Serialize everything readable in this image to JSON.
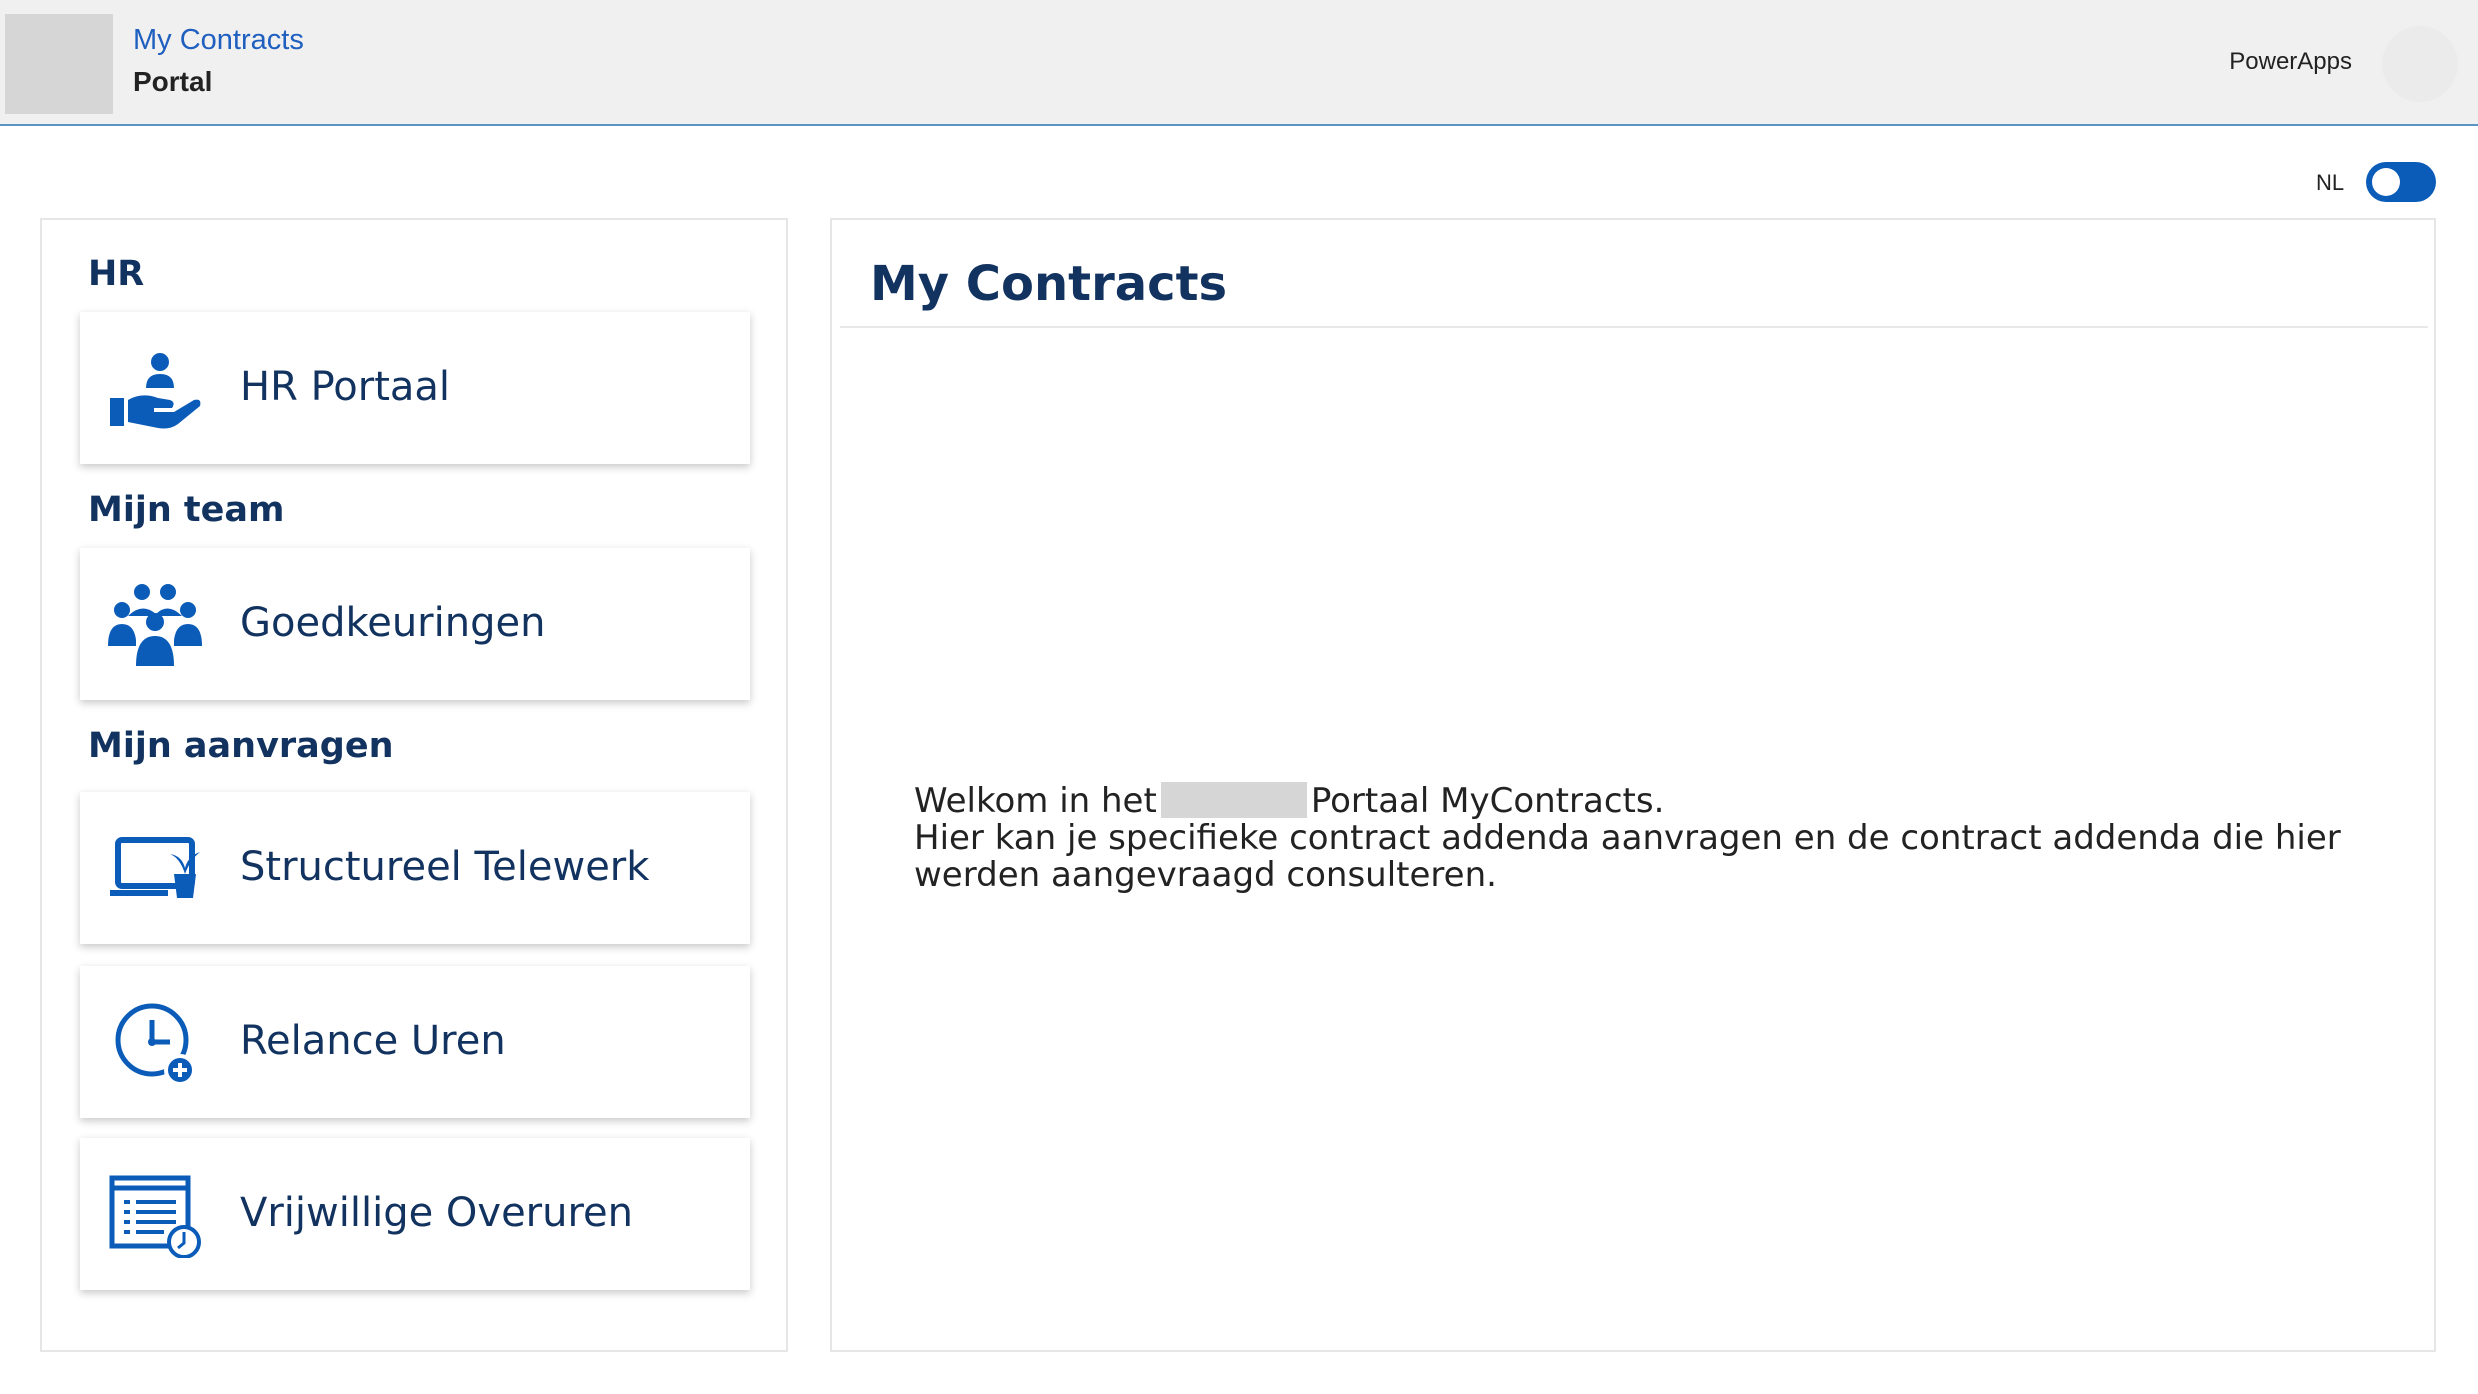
{
  "header": {
    "app_title": "My Contracts",
    "app_subtitle": "Portal",
    "powerapps_label": "PowerApps"
  },
  "language": {
    "label": "NL",
    "toggle_on": true
  },
  "sidebar": {
    "sections": [
      {
        "title": "HR",
        "items": [
          {
            "label": "HR Portaal",
            "icon": "hand-user-icon"
          }
        ]
      },
      {
        "title": "Mijn team",
        "items": [
          {
            "label": "Goedkeuringen",
            "icon": "team-group-icon"
          }
        ]
      },
      {
        "title": "Mijn aanvragen",
        "items": [
          {
            "label": "Structureel Telewerk",
            "icon": "laptop-plant-icon"
          },
          {
            "label": "Relance Uren",
            "icon": "clock-plus-icon"
          },
          {
            "label": "Vrijwillige Overuren",
            "icon": "document-clock-icon"
          }
        ]
      }
    ]
  },
  "main": {
    "title": "My Contracts",
    "welcome_part1": "Welkom in het",
    "welcome_part2": "Portaal MyContracts.",
    "welcome_line2": "Hier kan je specifieke contract addenda aanvragen en de contract addenda die hier werden aangevraagd consulteren."
  },
  "colors": {
    "accent": "#0b5cb8",
    "heading": "#12325f",
    "header_bg": "#f0f0f0",
    "link": "#1f5fbf"
  }
}
